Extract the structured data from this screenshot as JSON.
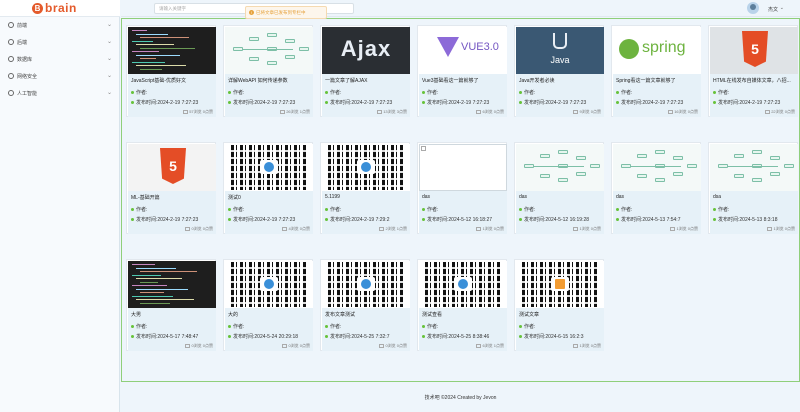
{
  "logo": {
    "badge": "B",
    "text": "brain"
  },
  "sidebar": {
    "items": [
      {
        "label": "前端"
      },
      {
        "label": "后端"
      },
      {
        "label": "数据库"
      },
      {
        "label": "网络安全"
      },
      {
        "label": "人工智能"
      }
    ]
  },
  "header": {
    "search_placeholder": "请输入关键字",
    "notice": "已将文章已发布到专栏中",
    "user_name": "杰文"
  },
  "card_labels": {
    "author": "作者:",
    "time_prefix": "发布时间:"
  },
  "cards": [
    {
      "title": "JavaScript基础-优质好文",
      "time": "2024-2-19 7:27:23",
      "stats": "57浏览 0点赞",
      "thumb": "code"
    },
    {
      "title": "详解WebAPI 如何传递参数",
      "time": "2024-2-19 7:27:23",
      "stats": "26浏览 1点赞",
      "thumb": "flow"
    },
    {
      "title": "一篇文章了解AJAX",
      "time": "2024-2-19 7:27:23",
      "stats": "13浏览 3点赞",
      "thumb": "ajax",
      "thumb_text": "Ajax"
    },
    {
      "title": "Vue3基础看这一篇就够了",
      "time": "2024-2-19 7:27:23",
      "stats": "6浏览 0点赞",
      "thumb": "vue",
      "thumb_text": "VUE3.0"
    },
    {
      "title": "Java开发者必读",
      "time": "2024-2-19 7:27:23",
      "stats": "9浏览 0点赞",
      "thumb": "java",
      "thumb_text": "Java"
    },
    {
      "title": "Spring看这一篇文章就够了",
      "time": "2024-2-19 7:27:23",
      "stats": "16浏览 0点赞",
      "thumb": "spring",
      "thumb_text": "spring"
    },
    {
      "title": "HTML在线发布自媒体文章，八招...",
      "time": "2024-2-19 7:27:23",
      "stats": "22浏览 0点赞",
      "thumb": "html5",
      "thumb_text": "5"
    },
    {
      "title": "ML-基础开篇",
      "time": "2024-2-19 7:27:23",
      "stats": "0浏览 0点赞",
      "thumb": "html5b",
      "thumb_text": "5"
    },
    {
      "title": "测试0",
      "time": "2024-2-19 7:27:23",
      "stats": "4浏览 0点赞",
      "thumb": "qr"
    },
    {
      "title": "5.1199",
      "time": "2024-2-19 7:29:2",
      "stats": "2浏览 1点赞",
      "thumb": "qr"
    },
    {
      "title": "das",
      "time": "2024-5-12 16:18:27",
      "stats": "1浏览 0点赞",
      "thumb": "blank"
    },
    {
      "title": "das",
      "time": "2024-5-12 16:19:28",
      "stats": "1浏览 0点赞",
      "thumb": "flow"
    },
    {
      "title": "das",
      "time": "2024-5-13 7:54:7",
      "stats": "1浏览 0点赞",
      "thumb": "flow"
    },
    {
      "title": "dsa",
      "time": "2024-5-13 8:3:18",
      "stats": "1浏览 0点赞",
      "thumb": "flow"
    },
    {
      "title": "大男",
      "time": "2024-5-17 7:48:47",
      "stats": "0浏览 0点赞",
      "thumb": "code"
    },
    {
      "title": "大的",
      "time": "2024-5-24 20:29:18",
      "stats": "0浏览 0点赞",
      "thumb": "qr"
    },
    {
      "title": "发布文章测试",
      "time": "2024-5-25 7:32:7",
      "stats": "0浏览 0点赞",
      "thumb": "qr"
    },
    {
      "title": "测试查看",
      "time": "2024-5-25 8:38:46",
      "stats": "6浏览 1点赞",
      "thumb": "qr"
    },
    {
      "title": "测试文章",
      "time": "2024-6-15 16:2:3",
      "stats": "1浏览 0点赞",
      "thumb": "qr-orange"
    }
  ],
  "footer": {
    "text": "技术吧 ©2024 Created by Jevon"
  },
  "colors": {
    "brand": "#e45b2c",
    "accent_green": "#67c23a",
    "notice_orange": "#e6a23c"
  }
}
